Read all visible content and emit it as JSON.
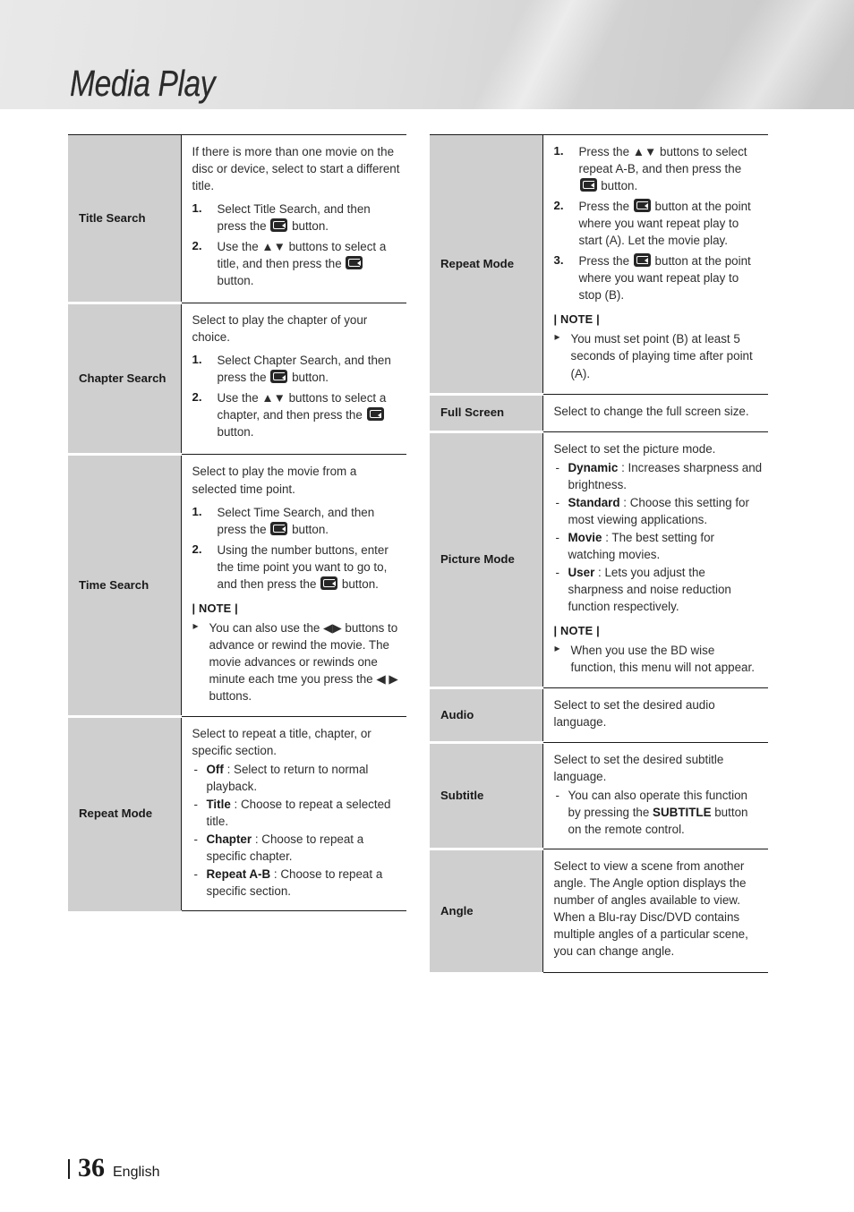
{
  "header": {
    "title": "Media Play"
  },
  "footer": {
    "page": "36",
    "language": "English"
  },
  "icons": {
    "enter_button": "enter-select-button-icon",
    "note_bullet": "triangle-bullet-icon"
  },
  "left_table": {
    "rows": [
      {
        "label": "Title Search",
        "intro": "If there is more than one movie on the disc or device, select to start a different title.",
        "steps": [
          {
            "pre": "Select Title Search, and then press the",
            "post": "button."
          },
          {
            "pre": "Use the ▲▼ buttons to select a title, and then press the",
            "post": "button."
          }
        ]
      },
      {
        "label": "Chapter Search",
        "intro": "Select to play the chapter of your choice.",
        "steps": [
          {
            "pre": "Select Chapter Search, and then press the",
            "post": "button."
          },
          {
            "pre": "Use the ▲▼ buttons to select a chapter, and then press the",
            "post": "button."
          }
        ]
      },
      {
        "label": "Time Search",
        "intro": "Select to play the movie from a selected time point.",
        "steps": [
          {
            "pre": "Select Time Search, and then press the",
            "post": "button."
          },
          {
            "pre": "Using the number buttons, enter the time point you want to go to, and then press the",
            "post": "button."
          }
        ],
        "note_head": "| NOTE |",
        "notes": [
          "You can also use the ◀▶ buttons to advance or rewind the movie. The movie advances or rewinds one minute each tme you press the ◀ ▶ buttons."
        ]
      },
      {
        "label": "Repeat Mode",
        "intro": "Select to repeat a title, chapter, or specific section.",
        "options": [
          {
            "term": "Off",
            "text": ": Select to return to normal playback."
          },
          {
            "term": "Title",
            "text": ": Choose to repeat a selected title."
          },
          {
            "term": "Chapter",
            "text": ": Choose to repeat a specific chapter."
          },
          {
            "term": "Repeat A-B",
            "text": ": Choose to repeat a specific section."
          }
        ]
      }
    ]
  },
  "right_table": {
    "rows": [
      {
        "label": "Repeat Mode",
        "steps": [
          {
            "pre": "Press the ▲▼ buttons to select repeat A-B, and then press the",
            "post": "button."
          },
          {
            "pre": "Press the",
            "post": "button at the point where you want repeat play to start (A). Let the movie play."
          },
          {
            "pre": "Press the",
            "post": "button at the point where you want repeat play to stop (B)."
          }
        ],
        "note_head": "| NOTE |",
        "notes": [
          "You must set point (B) at least 5 seconds of playing time after point (A)."
        ]
      },
      {
        "label": "Full Screen",
        "intro": "Select to change the full screen size."
      },
      {
        "label": "Picture Mode",
        "intro": "Select to set the picture mode.",
        "options": [
          {
            "term": "Dynamic",
            "text": ": Increases sharpness and brightness."
          },
          {
            "term": "Standard",
            "text": ": Choose this setting for most viewing applications."
          },
          {
            "term": "Movie",
            "text": ": The best setting for watching movies."
          },
          {
            "term": "User",
            "text": ": Lets you adjust the sharpness and noise reduction function respectively."
          }
        ],
        "note_head": "| NOTE |",
        "notes": [
          "When you use the BD wise function, this menu will not appear."
        ]
      },
      {
        "label": "Audio",
        "intro": "Select to set the desired audio language."
      },
      {
        "label": "Subtitle",
        "intro": "Select to set the desired subtitle language.",
        "options": [
          {
            "term": "",
            "pre": "You can also operate this function by pressing the ",
            "bold": "SUBTITLE",
            "post": " button on the remote control."
          }
        ]
      },
      {
        "label": "Angle",
        "intro": "Select to view a scene from another angle. The Angle option displays the number of angles available to view. When a Blu-ray Disc/DVD contains multiple angles of a particular scene, you can change angle."
      }
    ]
  }
}
